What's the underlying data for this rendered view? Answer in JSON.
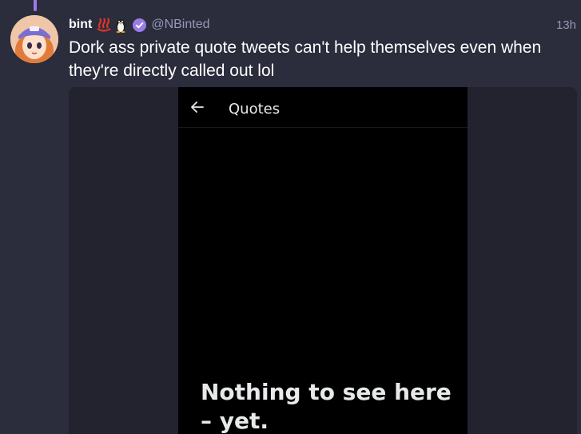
{
  "post": {
    "display_name": "bint",
    "badges": [
      "hot-springs-emoji",
      "penguin-emoji"
    ],
    "verified_icon": "verified-check-icon",
    "handle": "@NBinted",
    "timestamp": "13h",
    "text": "Dork ass private quote tweets can't help themselves even when they're directly called out lol"
  },
  "embedded_screenshot": {
    "back_icon": "back-arrow-icon",
    "title": "Quotes",
    "empty_message": "Nothing to see here – yet."
  },
  "colors": {
    "background": "#2b2c3c",
    "thread_accent": "#9b7be6",
    "verified": "#9b7be6",
    "muted_text": "#9698b8"
  }
}
